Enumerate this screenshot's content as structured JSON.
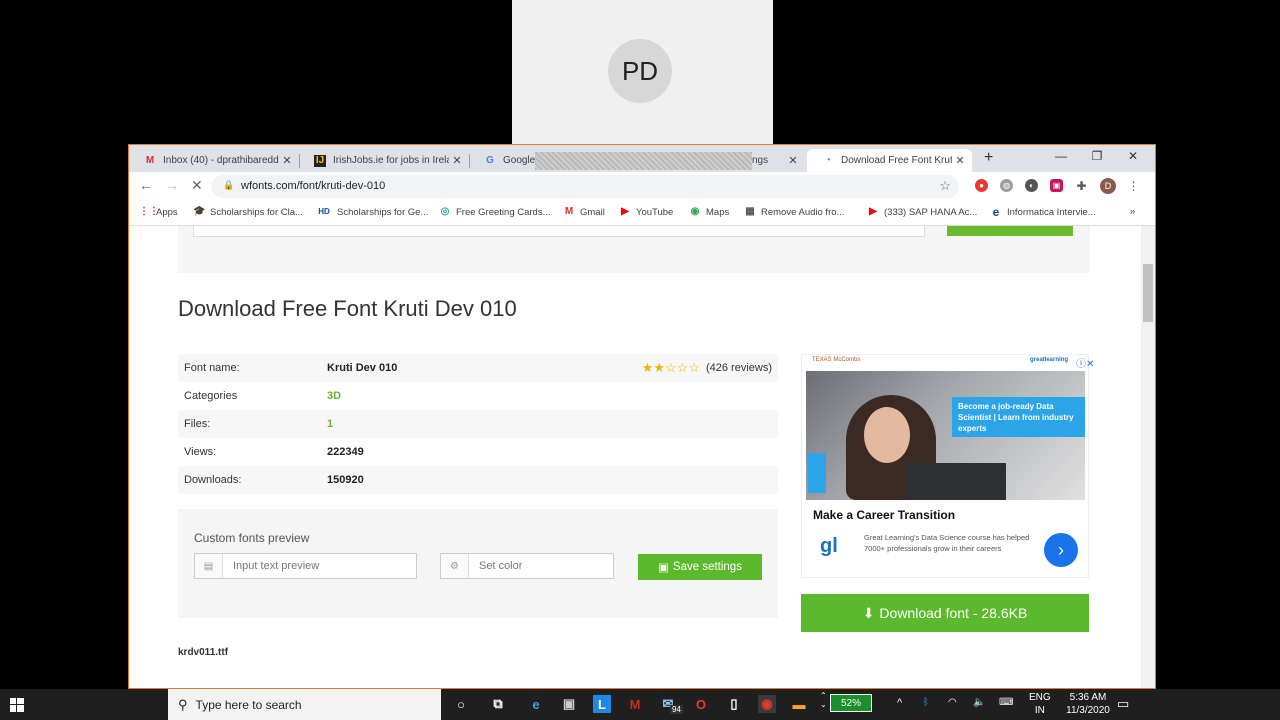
{
  "video_tile": {
    "initials": "PD"
  },
  "browser": {
    "tabs": [
      {
        "label": "Inbox (40) - dprathibaredd",
        "icon": "gmail-icon"
      },
      {
        "label": "IrishJobs.ie for jobs in Irela",
        "icon": "irishjobs-icon"
      },
      {
        "label": "Google",
        "icon": "google-icon"
      },
      {
        "label": "ngs",
        "icon": ""
      },
      {
        "label": "Download Free Font Kruti D",
        "icon": "wfonts-icon",
        "active": true
      }
    ],
    "url": "wfonts.com/font/kruti-dev-010",
    "bookmarks": [
      {
        "label": "Apps",
        "icon": "apps-grid-icon"
      },
      {
        "label": "Scholarships for Cla...",
        "icon": "graduation-icon"
      },
      {
        "label": "Scholarships for Ge...",
        "icon": "hd-icon"
      },
      {
        "label": "Free Greeting Cards...",
        "icon": "greeting-icon"
      },
      {
        "label": "Gmail",
        "icon": "gmail-icon"
      },
      {
        "label": "YouTube",
        "icon": "youtube-icon"
      },
      {
        "label": "Maps",
        "icon": "maps-icon"
      },
      {
        "label": "Remove Audio fro...",
        "icon": "film-icon"
      },
      {
        "label": "(333) SAP HANA Ac...",
        "icon": "youtube-icon"
      },
      {
        "label": "Informatica Intervie...",
        "icon": "e-icon"
      }
    ],
    "profile_initial": "D"
  },
  "page": {
    "title": "Download Free Font Kruti Dev 010",
    "font_info": [
      {
        "key": "Font name:",
        "value": "Kruti Dev 010"
      },
      {
        "key": "Categories",
        "value": "3D"
      },
      {
        "key": "Files:",
        "value": "1"
      },
      {
        "key": "Views:",
        "value": "222349"
      },
      {
        "key": "Downloads:",
        "value": "150920"
      }
    ],
    "rating": {
      "stars": 2,
      "max": 5,
      "reviews": "(426 reviews)"
    },
    "preview": {
      "label": "Custom fonts preview",
      "text_placeholder": "Input text preview",
      "color_placeholder": "Set color",
      "save_label": "Save settings"
    },
    "download_label": "Download font - 28.6KB",
    "filename": "krdv011.ttf",
    "ad": {
      "title": "Make a Career Transition",
      "text": "Great Learning's Data Science course has helped 7000+ professionals grow in their careers",
      "bubble": "Become a job-ready Data Scientist | Learn from industry experts",
      "brand_left": "TEXAS McCombs",
      "brand_right": "greatlearning",
      "logo": "gl"
    }
  },
  "taskbar": {
    "search_placeholder": "Type here to search",
    "badge_count": "94",
    "battery": "52%",
    "language": "ENG",
    "region": "IN",
    "time": "5:36 AM",
    "date": "11/3/2020"
  },
  "colors": {
    "accent_green": "#5cb82c",
    "window_border": "#e07a3a"
  }
}
